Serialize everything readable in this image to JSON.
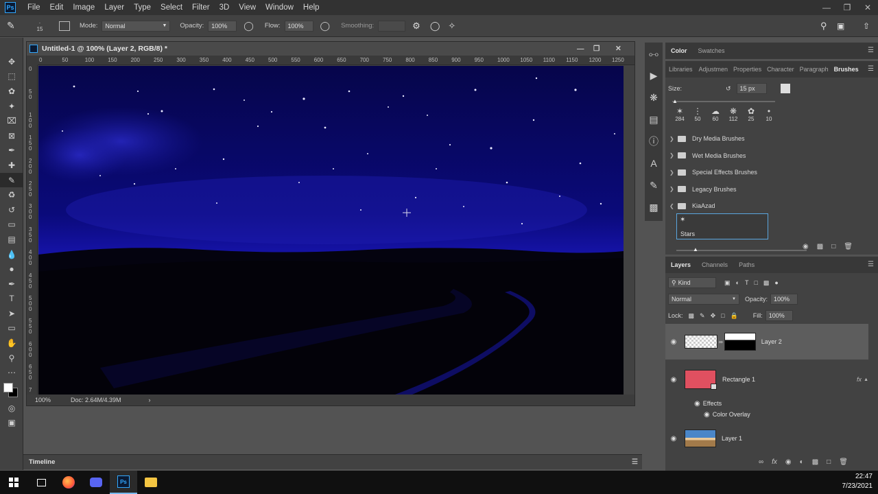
{
  "app": {
    "logo": "Ps",
    "menu": [
      "File",
      "Edit",
      "Image",
      "Layer",
      "Type",
      "Select",
      "Filter",
      "3D",
      "View",
      "Window",
      "Help"
    ]
  },
  "options_bar": {
    "brush_size": "15",
    "mode_label": "Mode:",
    "mode_value": "Normal",
    "opacity_label": "Opacity:",
    "opacity_value": "100%",
    "flow_label": "Flow:",
    "flow_value": "100%",
    "smoothing_label": "Smoothing:"
  },
  "document": {
    "tab_title": "Untitled-1 @ 100% (Layer 2, RGB/8) *",
    "ruler_h_ticks": [
      "0",
      "50",
      "100",
      "150",
      "200",
      "250",
      "300",
      "350",
      "400",
      "450",
      "500",
      "550",
      "600",
      "650",
      "700",
      "750",
      "800",
      "850",
      "900",
      "950",
      "1000",
      "1050",
      "1100",
      "1150",
      "1200",
      "1250"
    ],
    "ruler_v_ticks": [
      "0",
      "5\n0",
      "1\n0\n0",
      "1\n5\n0",
      "2\n0\n0",
      "2\n5\n0",
      "3\n0\n0",
      "3\n5\n0",
      "4\n0\n0",
      "4\n5\n0",
      "5\n0\n0",
      "5\n5\n0",
      "6\n0\n0",
      "6\n5\n0",
      "7"
    ],
    "zoom": "100%",
    "doc_size": "Doc: 2.64M/4.39M"
  },
  "timeline": {
    "label": "Timeline"
  },
  "color_panel": {
    "tabs": [
      "Color",
      "Swatches"
    ]
  },
  "brushes_panel": {
    "tabs": [
      "Libraries",
      "Adjustmen",
      "Properties",
      "Character",
      "Paragraph",
      "Brushes"
    ],
    "size_label": "Size:",
    "size_value": "15 px",
    "presets": [
      "284",
      "50",
      "60",
      "112",
      "25",
      "10"
    ],
    "folders": [
      "Dry Media Brushes",
      "Wet Media Brushes",
      "Special Effects Brushes",
      "Legacy Brushes",
      "KiaAzad"
    ],
    "selected_brush": "Stars"
  },
  "layers_panel": {
    "tabs": [
      "Layers",
      "Channels",
      "Paths"
    ],
    "filter": "Kind",
    "blend_mode": "Normal",
    "opacity_label": "Opacity:",
    "opacity_value": "100%",
    "lock_label": "Lock:",
    "fill_label": "Fill:",
    "fill_value": "100%",
    "layers": [
      {
        "name": "Layer 2",
        "selected": true
      },
      {
        "name": "Rectangle 1",
        "color": "#e05060",
        "fx": "fx"
      },
      {
        "name": "Layer 1"
      }
    ],
    "effects_label": "Effects",
    "effect_item": "Color Overlay"
  },
  "taskbar": {
    "time": "22:47",
    "date": "7/23/2021"
  }
}
